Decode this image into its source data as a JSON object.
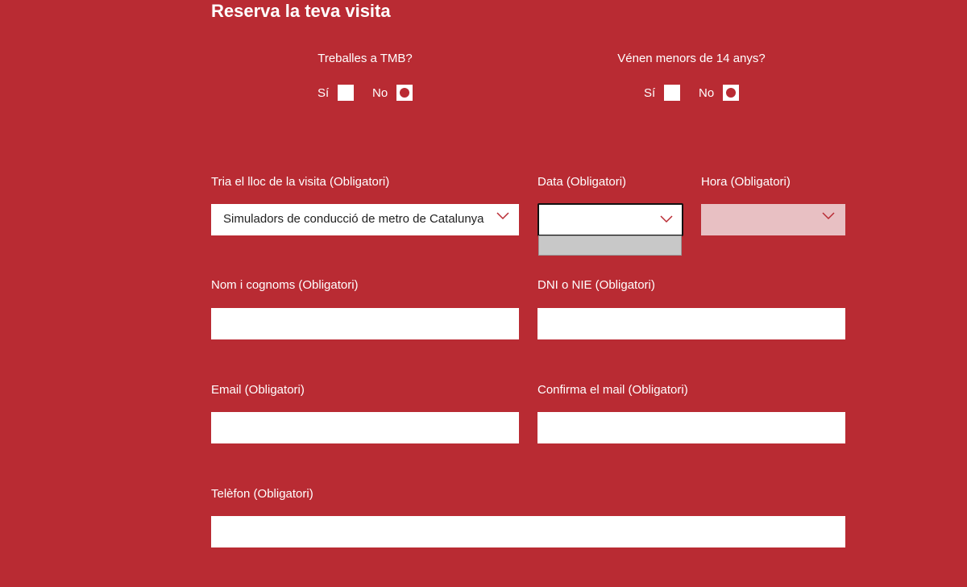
{
  "form": {
    "title": "Reserva la teva visita"
  },
  "questions": {
    "tmb": {
      "label": "Treballes a TMB?",
      "yes_label": "Sí",
      "no_label": "No",
      "selected": "No"
    },
    "minors": {
      "label": "Vénen menors de 14 anys?",
      "yes_label": "Sí",
      "no_label": "No",
      "selected": "No"
    }
  },
  "fields": {
    "place": {
      "label": "Tria el lloc de la visita (Obligatori)",
      "value": "Simuladors de conducció de metro de Catalunya"
    },
    "date": {
      "label": "Data (Obligatori)",
      "value": ""
    },
    "time": {
      "label": "Hora (Obligatori)",
      "value": ""
    },
    "name": {
      "label": "Nom i cognoms (Obligatori)",
      "value": ""
    },
    "dni": {
      "label": "DNI o NIE (Obligatori)",
      "value": ""
    },
    "email": {
      "label": "Email (Obligatori)",
      "value": ""
    },
    "email_confirm": {
      "label": "Confirma el mail (Obligatori)",
      "value": ""
    },
    "phone": {
      "label": "Telèfon (Obligatori)",
      "value": ""
    }
  },
  "colors": {
    "background": "#b92b33",
    "chevron": "#b92b33",
    "disabled_select": "#e8c0c3",
    "dropdown_panel": "#c8c8c8"
  },
  "icons": {
    "select_arrow": "chevron-down-icon"
  }
}
